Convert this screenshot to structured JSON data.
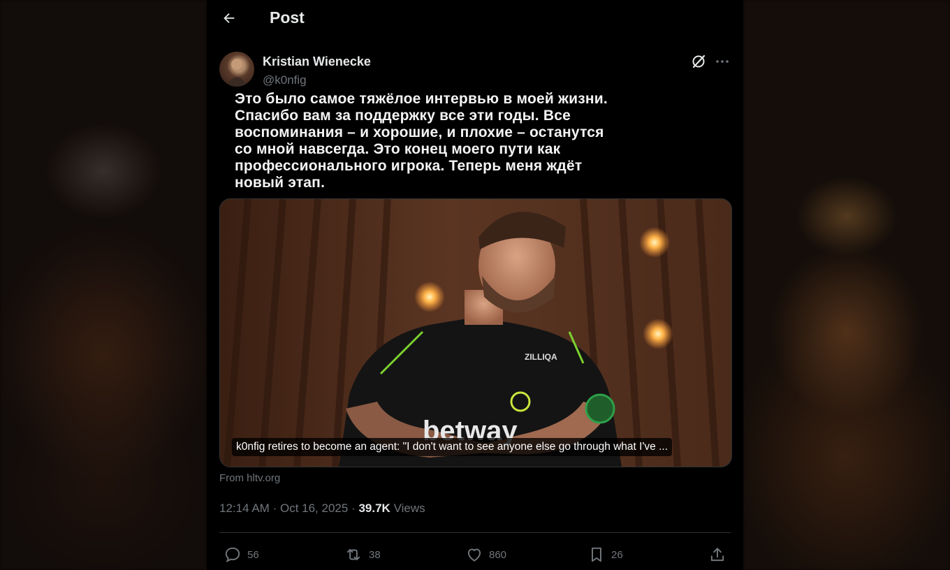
{
  "header": {
    "title": "Post",
    "back_icon": "arrow-left-icon"
  },
  "post": {
    "author_name": "Kristian Wienecke",
    "author_handle": "@k0nfig",
    "text": "Это было самое тяжёлое интервью в моей жизни.\nСпасибо вам за поддержку все эти годы. Все\nвоспоминания – и хорошие, и плохие – останутся\nсо мной навсегда. Это конец моего пути как\nпрофессионального игрока. Теперь меня ждёт\nновый этап.",
    "card_caption": "k0nfig retires to become an agent: \"I don't want to see anyone else go through what I've ...",
    "jersey_sponsor": "betway",
    "jersey_partner": "ZILLIQA",
    "source": "From hltv.org",
    "time": "12:14 AM",
    "date": "Oct 16, 2025",
    "separator": "·",
    "views_count": "39.7K",
    "views_label": "Views"
  },
  "actions": {
    "replies": "56",
    "reposts": "38",
    "likes": "860",
    "bookmarks": "26"
  },
  "colors": {
    "background": "#000000",
    "text_primary": "#e7e9ea",
    "text_secondary": "#71767b",
    "divider": "#2f3336"
  }
}
